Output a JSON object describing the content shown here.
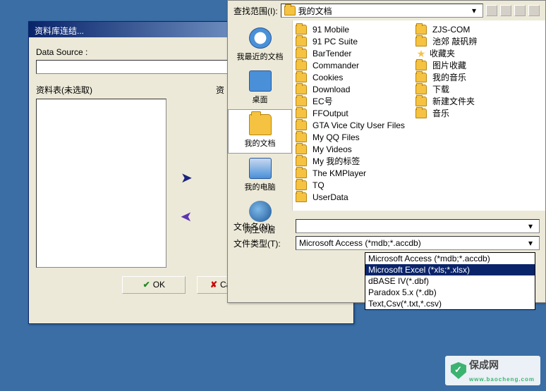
{
  "back_window": {
    "title": "资料库连结...",
    "data_source_label": "Data Source :",
    "tables_label": "资料表(未选取)",
    "selected_label": "资",
    "ok_label": "OK",
    "cancel_label": "Cancel"
  },
  "file_dialog": {
    "lookin_label": "查找范围(I):",
    "lookin_value": "我的文档",
    "places": {
      "recent": "我最近的文档",
      "desktop": "桌面",
      "documents": "我的文档",
      "computer": "我的电脑",
      "network": "网上邻居"
    },
    "files_col1": [
      {
        "n": "91 Mobile",
        "t": "folder"
      },
      {
        "n": "91 PC Suite",
        "t": "folder"
      },
      {
        "n": "BarTender",
        "t": "folder"
      },
      {
        "n": "Commander",
        "t": "folder"
      },
      {
        "n": "Cookies",
        "t": "folder"
      },
      {
        "n": "Download",
        "t": "folder"
      },
      {
        "n": "EC号",
        "t": "folder"
      },
      {
        "n": "FFOutput",
        "t": "folder"
      },
      {
        "n": "GTA Vice City User Files",
        "t": "folder"
      },
      {
        "n": "My QQ Files",
        "t": "folder"
      },
      {
        "n": "My Videos",
        "t": "folder"
      },
      {
        "n": "My 我的标签",
        "t": "folder"
      },
      {
        "n": "The KMPlayer",
        "t": "folder"
      },
      {
        "n": "TQ",
        "t": "folder"
      },
      {
        "n": "UserData",
        "t": "folder"
      }
    ],
    "files_col2": [
      {
        "n": "ZJS-COM",
        "t": "folder"
      },
      {
        "n": "池郊 敲矾辨",
        "t": "folder"
      },
      {
        "n": "收藏夹",
        "t": "fav"
      },
      {
        "n": "图片收藏",
        "t": "folder"
      },
      {
        "n": "我的音乐",
        "t": "folder"
      },
      {
        "n": "下载",
        "t": "folder"
      },
      {
        "n": "新建文件夹",
        "t": "folder"
      },
      {
        "n": "音乐",
        "t": "folder"
      }
    ],
    "filename_label": "文件名(N):",
    "filetype_label": "文件类型(T):",
    "filetype_value": "Microsoft Access (*mdb;*.accdb)",
    "type_options": [
      "Microsoft Access (*mdb;*.accdb)",
      "Microsoft Excel (*xls;*.xlsx)",
      "dBASE IV(*.dbf)",
      "Paradox 5.x (*.db)",
      "Text,Csv(*.txt,*.csv)"
    ],
    "selected_option_index": 1
  },
  "watermark": {
    "text": "保成网",
    "domain": "www.baocheng.com"
  }
}
